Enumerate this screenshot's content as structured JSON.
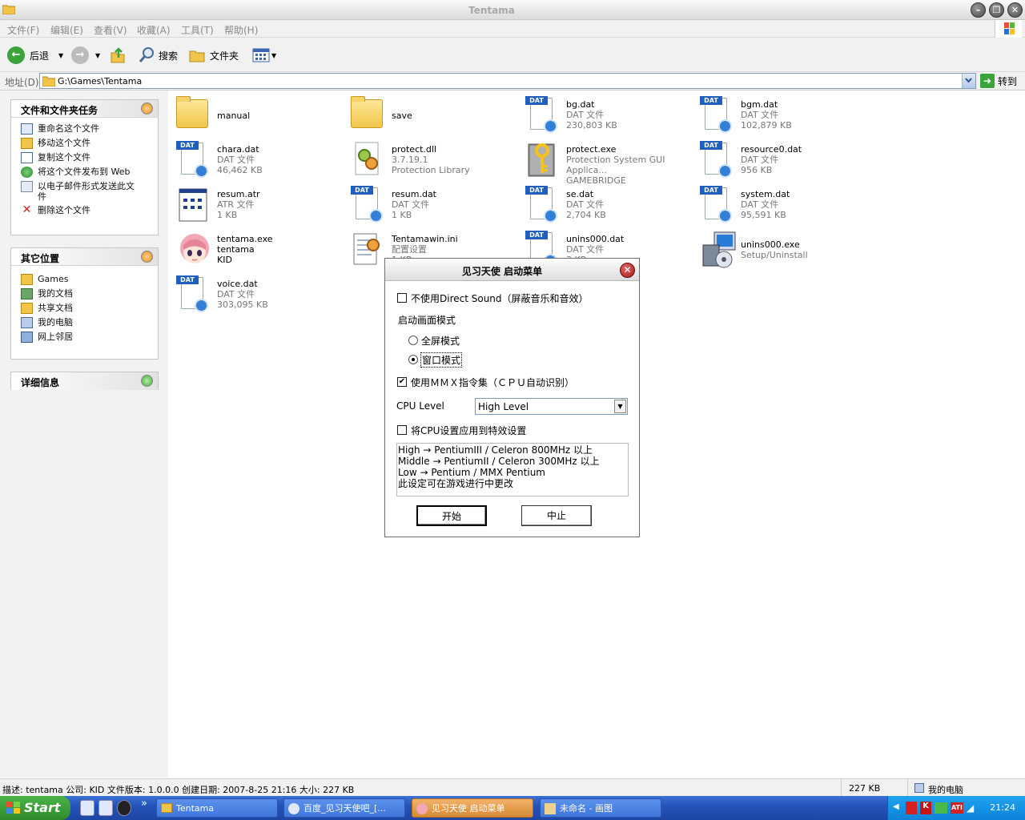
{
  "window": {
    "title": "Tentama"
  },
  "menu": [
    "文件(F)",
    "编辑(E)",
    "查看(V)",
    "收藏(A)",
    "工具(T)",
    "帮助(H)"
  ],
  "toolbar": {
    "back": "后退",
    "search": "搜索",
    "folders": "文件夹"
  },
  "address": {
    "label": "地址(D)",
    "value": "G:\\Games\\Tentama",
    "go": "转到"
  },
  "tasks": {
    "title": "文件和文件夹任务",
    "items": [
      "重命名这个文件",
      "移动这个文件",
      "复制这个文件",
      "将这个文件发布到 Web",
      "以电子邮件形式发送此文件",
      "删除这个文件"
    ]
  },
  "places": {
    "title": "其它位置",
    "items": [
      "Games",
      "我的文档",
      "共享文档",
      "我的电脑",
      "网上邻居"
    ]
  },
  "details": {
    "title": "详细信息"
  },
  "files": [
    {
      "name": "manual",
      "l1": "",
      "l2": "",
      "icon": "folder"
    },
    {
      "name": "save",
      "l1": "",
      "l2": "",
      "icon": "folder"
    },
    {
      "name": "bg.dat",
      "l1": "DAT 文件",
      "l2": "230,803 KB",
      "icon": "dat"
    },
    {
      "name": "bgm.dat",
      "l1": "DAT 文件",
      "l2": "102,879 KB",
      "icon": "dat"
    },
    {
      "name": "chara.dat",
      "l1": "DAT 文件",
      "l2": "46,462 KB",
      "icon": "dat"
    },
    {
      "name": "protect.dll",
      "l1": "3.7.19.1",
      "l2": "Protection Library",
      "icon": "dll"
    },
    {
      "name": "protect.exe",
      "l1": "Protection System GUI Applica...",
      "l2": "GAMEBRIDGE",
      "icon": "exe-key"
    },
    {
      "name": "resource0.dat",
      "l1": "DAT 文件",
      "l2": "956 KB",
      "icon": "dat"
    },
    {
      "name": "resum.atr",
      "l1": "ATR 文件",
      "l2": "1 KB",
      "icon": "atr"
    },
    {
      "name": "resum.dat",
      "l1": "DAT 文件",
      "l2": "1 KB",
      "icon": "dat"
    },
    {
      "name": "se.dat",
      "l1": "DAT 文件",
      "l2": "2,704 KB",
      "icon": "dat"
    },
    {
      "name": "system.dat",
      "l1": "DAT 文件",
      "l2": "95,591 KB",
      "icon": "dat"
    },
    {
      "name": "tentama.exe",
      "l1": "tentama",
      "l2": "KID",
      "icon": "character"
    },
    {
      "name": "Tentamawin.ini",
      "l1": "配置设置",
      "l2": "1 KB",
      "icon": "ini"
    },
    {
      "name": "unins000.dat",
      "l1": "DAT 文件",
      "l2": "3 KB",
      "icon": "dat"
    },
    {
      "name": "unins000.exe",
      "l1": "Setup/Uninstall",
      "l2": "",
      "icon": "setup"
    },
    {
      "name": "voice.dat",
      "l1": "DAT 文件",
      "l2": "303,095 KB",
      "icon": "dat"
    }
  ],
  "dialog": {
    "title": "见习天使 启动菜单",
    "no_sound": "不使用Direct Sound（屏蔽音乐和音效）",
    "mode_label": "启动画面模式",
    "fullscreen": "全屏模式",
    "windowed": "窗口模式",
    "mmx": "使用ＭＭＸ指令集（ＣＰＵ自动识别）",
    "cpu_label": "CPU Level",
    "cpu_value": "High Level",
    "apply_cpu": "将CPU设置应用到特效设置",
    "info": [
      "High → PentiumIII / Celeron 800MHz 以上",
      "Middle → PentiumII / Celeron 300MHz 以上",
      "Low → Pentium / MMX Pentium",
      "此设定可在游戏进行中更改"
    ],
    "start": "开始",
    "cancel": "中止",
    "no_sound_checked": false,
    "mmx_checked": true,
    "apply_checked": false,
    "mode_selected": "windowed"
  },
  "status": {
    "desc": "描述: tentama 公司: KID 文件版本: 1.0.0.0 创建日期: 2007-8-25 21:16 大小: 227 KB",
    "size": "227 KB",
    "location": "我的电脑"
  },
  "taskbar": {
    "start": "Start",
    "quick_overflow": "»",
    "tasks": [
      "Tentama",
      "百度_见习天使吧_[...",
      "见习天使 启动菜单",
      "未命名 - 画图"
    ],
    "clock": "21:24"
  },
  "colors": {
    "accent": "#3a6fd8",
    "start": "#3a9a38",
    "active_task": "#e39a48"
  }
}
